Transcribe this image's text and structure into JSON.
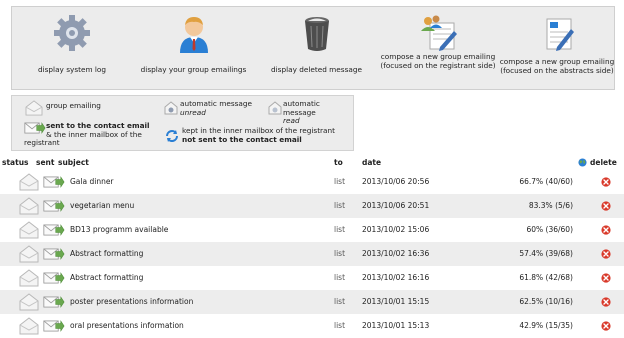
{
  "toolbar": {
    "system_log": "display system log",
    "group_emailings": "display your group emailings",
    "deleted_message": "display deleted message",
    "compose_registrant": "compose a new group emailing (focused on the registrant side)",
    "compose_abstracts": "compose a new group emailing (focused on the abstracts side)"
  },
  "legend": {
    "group_emailing": "group emailing",
    "auto_msg": "automatic message",
    "unread": "unread",
    "read": "read",
    "sent_bold": "sent to the contact email",
    "sent_rest": "& the inner mailbox of the registrant",
    "kept_line1": "kept in the inner mailbox of the registrant",
    "kept_line2": "not sent to the contact email"
  },
  "table": {
    "headers": {
      "status": "status",
      "sent": "sent",
      "subject": "subject",
      "to": "to",
      "date": "date",
      "delete": "delete"
    },
    "rows": [
      {
        "subject": "Gala dinner",
        "to": "list",
        "date": "2013/10/06 20:56",
        "stats": "66.7% (40/60)"
      },
      {
        "subject": "vegetarian menu",
        "to": "list",
        "date": "2013/10/06 20:51",
        "stats": "83.3% (5/6)"
      },
      {
        "subject": "BD13 programm available",
        "to": "list",
        "date": "2013/10/02 15:06",
        "stats": "60% (36/60)"
      },
      {
        "subject": "Abstract formatting",
        "to": "list",
        "date": "2013/10/02 16:36",
        "stats": "57.4% (39/68)"
      },
      {
        "subject": "Abstract formatting",
        "to": "list",
        "date": "2013/10/02 16:16",
        "stats": "61.8% (42/68)"
      },
      {
        "subject": "poster presentations information",
        "to": "list",
        "date": "2013/10/01 15:15",
        "stats": "62.5% (10/16)"
      },
      {
        "subject": "oral presentations information",
        "to": "list",
        "date": "2013/10/01 15:13",
        "stats": "42.9% (15/35)"
      }
    ]
  },
  "colors": {
    "delete": "#d93a2b",
    "accent_blue": "#2a7fd4",
    "envelope_green": "#6aa84f"
  }
}
